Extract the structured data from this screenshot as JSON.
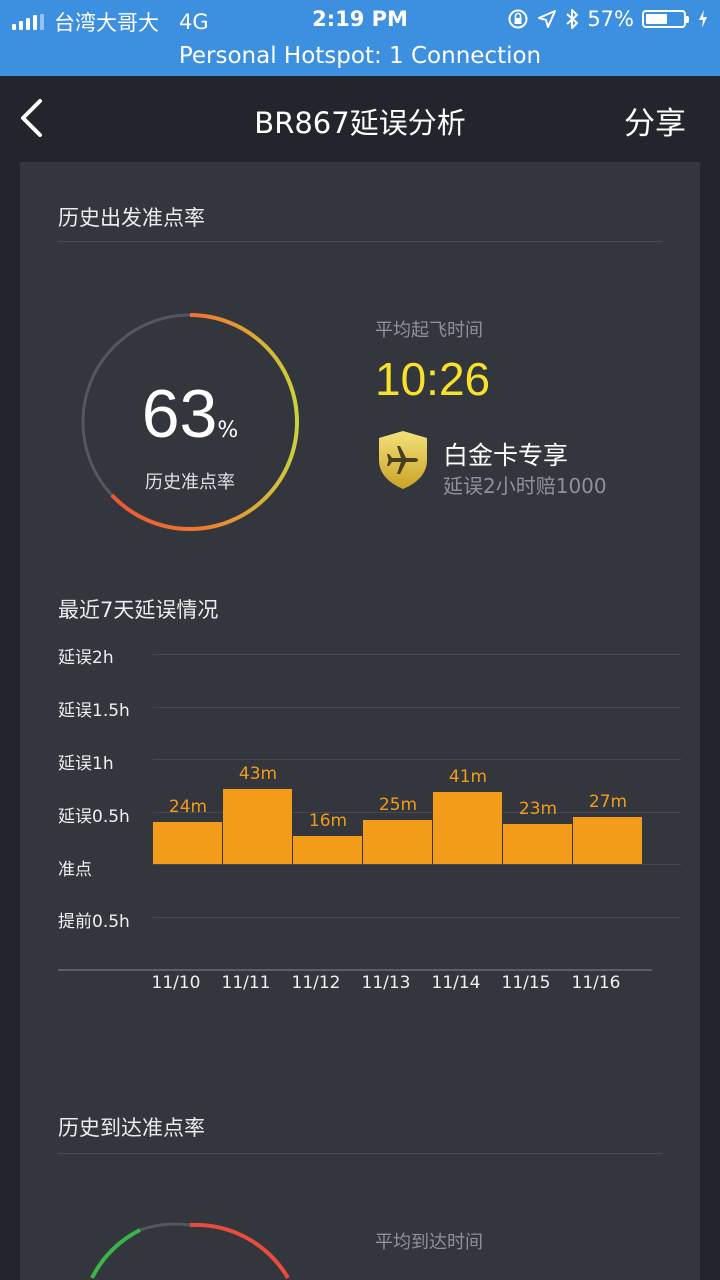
{
  "status_bar": {
    "carrier": "台湾大哥大",
    "network": "4G",
    "time": "2:19 PM",
    "battery_percent": "57%",
    "battery_level": 0.57,
    "icons": [
      "signal-icon",
      "lock-rotation-icon",
      "location-icon",
      "bluetooth-icon",
      "battery-icon",
      "charging-icon"
    ]
  },
  "hotspot": {
    "text": "Personal Hotspot: 1 Connection"
  },
  "nav": {
    "title": "BR867延误分析",
    "share_label": "分享"
  },
  "departure": {
    "section_title": "历史出发准点率",
    "rate_value": "63",
    "rate_unit": "%",
    "rate_label": "历史准点率",
    "rate_fraction": 0.63,
    "avg_label": "平均起飞时间",
    "avg_time": "10:26",
    "platinum_title": "白金卡专享",
    "platinum_sub": "延误2小时赔1000",
    "accent_color": "#f7e12a"
  },
  "delay_chart": {
    "section_title": "最近7天延误情况",
    "y_labels": [
      "延误2h",
      "延误1.5h",
      "延误1h",
      "延误0.5h",
      "准点",
      "提前0.5h"
    ],
    "bar_color": "#f29c1a"
  },
  "chart_data": {
    "type": "bar",
    "title": "最近7天延误情况",
    "categories": [
      "11/10",
      "11/11",
      "11/12",
      "11/13",
      "11/14",
      "11/15",
      "11/16"
    ],
    "values": [
      24,
      43,
      16,
      25,
      41,
      23,
      27
    ],
    "value_labels": [
      "24m",
      "43m",
      "16m",
      "25m",
      "41m",
      "23m",
      "27m"
    ],
    "unit": "minutes",
    "ylim": [
      -30,
      120
    ],
    "grid": true
  },
  "arrival": {
    "section_title": "历史到达准点率",
    "avg_label": "平均到达时间"
  }
}
